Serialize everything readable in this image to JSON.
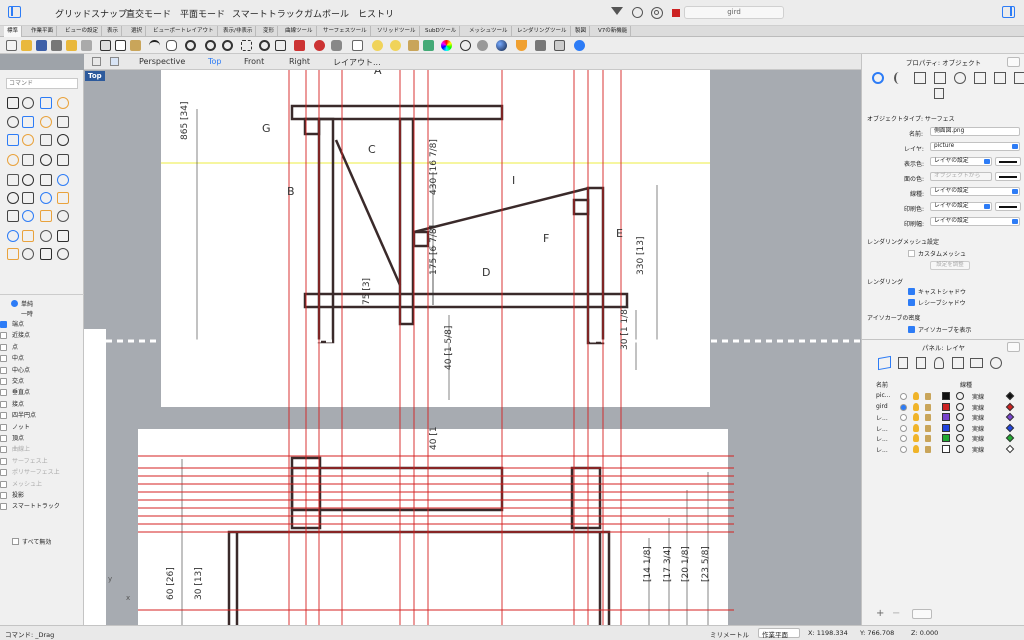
{
  "titlebar": {
    "items": [
      "グリッドスナップ",
      "直交モード",
      "平面モード",
      "スマートトラック",
      "ガムボール",
      "ヒストリ"
    ],
    "current_layer": "gird"
  },
  "tabs": [
    "標準",
    "作業平面",
    "ビューの設定",
    "表示",
    "選択",
    "ビューポートレイアウト",
    "表示/非表示",
    "変形",
    "曲線ツール",
    "サーフェスツール",
    "ソリッドツール",
    "SubDツール",
    "メッシュツール",
    "レンダリングツール",
    "製図",
    "V7の新機能"
  ],
  "command": {
    "placeholder": "コマンド"
  },
  "viewtabs": {
    "items": [
      "Perspective",
      "Top",
      "Front",
      "Right",
      "レイアウト..."
    ],
    "active": "Top"
  },
  "viewport": {
    "label": "Top"
  },
  "snaps": {
    "mode_items": [
      "単純",
      "一時"
    ],
    "items": [
      {
        "label": "端点",
        "on": true,
        "dis": false
      },
      {
        "label": "近接点",
        "on": false,
        "dis": false
      },
      {
        "label": "点",
        "on": false,
        "dis": false
      },
      {
        "label": "中点",
        "on": false,
        "dis": false
      },
      {
        "label": "中心点",
        "on": false,
        "dis": false
      },
      {
        "label": "交点",
        "on": false,
        "dis": false
      },
      {
        "label": "垂直点",
        "on": false,
        "dis": false
      },
      {
        "label": "接点",
        "on": false,
        "dis": false
      },
      {
        "label": "四半円点",
        "on": false,
        "dis": false
      },
      {
        "label": "ノット",
        "on": false,
        "dis": false
      },
      {
        "label": "頂点",
        "on": false,
        "dis": false
      },
      {
        "label": "曲線上",
        "on": false,
        "dis": true
      },
      {
        "label": "サーフェス上",
        "on": false,
        "dis": true
      },
      {
        "label": "ポリサーフェス上",
        "on": false,
        "dis": true
      },
      {
        "label": "メッシュ上",
        "on": false,
        "dis": true
      },
      {
        "label": "投影",
        "on": false,
        "dis": false
      },
      {
        "label": "スマートトラック",
        "on": false,
        "dis": false
      }
    ],
    "disable_all": "すべて無効"
  },
  "properties": {
    "title": "プロパティ: オブジェクト",
    "object_type": "オブジェクトタイプ: サーフェス",
    "name_label": "名前:",
    "name_value": "側面図.png",
    "layer_label": "レイヤ:",
    "layer_value": "picture",
    "display_color_label": "表示色:",
    "display_color_value": "レイヤの設定",
    "iso_color_label": "面の色:",
    "iso_color_value": "オブジェクトから",
    "linetype_label": "線種:",
    "linetype_value": "レイヤの設定",
    "print_color_label": "印刷色:",
    "print_color_value": "レイヤの設定",
    "print_width_label": "印刷幅:",
    "print_width_value": "レイヤの設定",
    "render_mesh_header": "レンダリングメッシュ設定",
    "custom_mesh": "カスタムメッシュ",
    "adjust_button": "設定を調整",
    "rendering_header": "レンダリング",
    "cast_shadows": "キャストシャドウ",
    "receive_shadows": "レシーブシャドウ",
    "isocurve_header": "アイソカーブの密度",
    "show_isocurves": "アイソカーブを表示"
  },
  "layers": {
    "title": "パネル: レイヤ",
    "col_name": "名前",
    "col_linetype": "線種",
    "rows": [
      {
        "name": "pic...",
        "color": "#111111",
        "linetype": "実線",
        "current": false
      },
      {
        "name": "gird",
        "color": "#cc2222",
        "linetype": "実線",
        "current": true
      },
      {
        "name": "レ...",
        "color": "#7744cc",
        "linetype": "実線",
        "current": false
      },
      {
        "name": "レ...",
        "color": "#2244dd",
        "linetype": "実線",
        "current": false
      },
      {
        "name": "レ...",
        "color": "#22aa33",
        "linetype": "実線",
        "current": false
      },
      {
        "name": "レ...",
        "color": "#ffffff",
        "linetype": "実線",
        "current": false
      }
    ]
  },
  "statusbar": {
    "command": "コマンド: _Drag",
    "units": "ミリメートル",
    "cplane": "作業平面",
    "x": "X: 1198.334",
    "y": "Y: 766.708",
    "z": "Z: 0.000"
  },
  "drawing": {
    "labels": [
      "A",
      "B",
      "C",
      "D",
      "E",
      "F",
      "G",
      "I"
    ],
    "dims": [
      "865 [34]",
      "430 [16 7/8]",
      "175 [6 7/8]",
      "75 [3]",
      "40 [1 5/8]",
      "330 [13]",
      "30 [1 1/8]",
      "40 [1",
      "60 [26]",
      "30 [13]",
      "[14 1/8]",
      "[17 3/4]",
      "[20 1/8]",
      "[23 5/8]"
    ],
    "axis_y": "y",
    "axis_x": "x"
  },
  "colors": {
    "accent": "#2d7cf6",
    "grid_red": "#d42020",
    "yellow_line": "#e6e600"
  }
}
